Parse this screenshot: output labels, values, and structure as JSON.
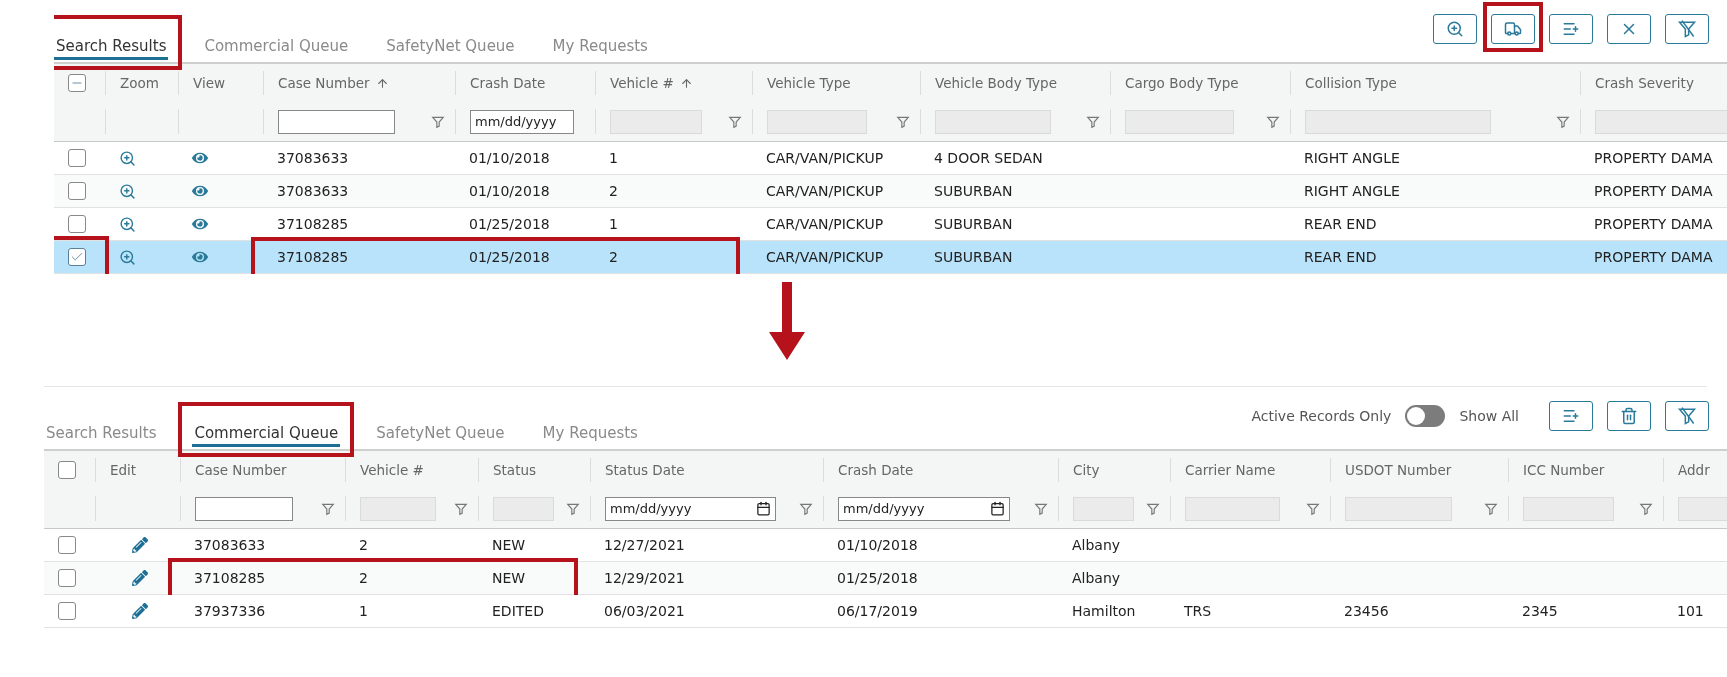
{
  "panels": [
    {
      "tabs": [
        {
          "label": "Search Results",
          "selected": true,
          "callout": true
        },
        {
          "label": "Commercial Queue",
          "selected": false,
          "callout": false
        },
        {
          "label": "SafetyNet Queue",
          "selected": false,
          "callout": false
        },
        {
          "label": "My Requests",
          "selected": false,
          "callout": false
        }
      ],
      "toolbar": [
        {
          "kind": "zoom",
          "callout": false
        },
        {
          "kind": "truck",
          "callout": true
        },
        {
          "kind": "add-list",
          "callout": false
        },
        {
          "kind": "close",
          "callout": false
        },
        {
          "kind": "clear-filter",
          "callout": false
        }
      ],
      "table": {
        "header_checkbox": {
          "indeterminate": true
        },
        "columns": [
          {
            "kind": "select"
          },
          {
            "kind": "zoom",
            "label": "Zoom"
          },
          {
            "kind": "view",
            "label": "View"
          },
          {
            "kind": "text",
            "label": "Case Number",
            "sorted": true,
            "callout": true,
            "filter": {
              "kind": "text",
              "button": true
            }
          },
          {
            "kind": "text",
            "label": "Crash Date",
            "sorted": false,
            "callout": true,
            "filter": {
              "kind": "date",
              "placeholder": "mm/dd/yyyy",
              "picker": false,
              "button": false
            }
          },
          {
            "kind": "text",
            "label": "Vehicle #",
            "sorted": true,
            "callout": true,
            "filter": {
              "kind": "disabled",
              "button": true
            }
          },
          {
            "kind": "text",
            "label": "Vehicle Type",
            "sorted": false,
            "callout": false,
            "filter": {
              "kind": "disabled",
              "button": true
            }
          },
          {
            "kind": "text",
            "label": "Vehicle Body Type",
            "sorted": false,
            "callout": false,
            "filter": {
              "kind": "disabled",
              "button": true
            }
          },
          {
            "kind": "text",
            "label": "Cargo Body Type",
            "sorted": false,
            "callout": false,
            "filter": {
              "kind": "disabled",
              "button": true
            }
          },
          {
            "kind": "text",
            "label": "Collision Type",
            "sorted": false,
            "callout": false,
            "filter": {
              "kind": "disabled",
              "button": true
            }
          },
          {
            "kind": "text",
            "label": "Crash Severity",
            "sorted": false,
            "callout": false,
            "filter": {
              "kind": "disabled"
            }
          }
        ],
        "rows": [
          {
            "selected": false,
            "checkbox_callout": false,
            "callout": false,
            "cells": [
              "",
              "",
              "",
              "37083633",
              "01/10/2018",
              "1",
              "CAR/VAN/PICKUP",
              "4 DOOR SEDAN",
              "",
              "RIGHT ANGLE",
              "PROPERTY DAMA"
            ]
          },
          {
            "selected": false,
            "checkbox_callout": false,
            "callout": false,
            "cells": [
              "",
              "",
              "",
              "37083633",
              "01/10/2018",
              "2",
              "CAR/VAN/PICKUP",
              "SUBURBAN",
              "",
              "RIGHT ANGLE",
              "PROPERTY DAMA"
            ]
          },
          {
            "selected": false,
            "checkbox_callout": false,
            "callout": false,
            "cells": [
              "",
              "",
              "",
              "37108285",
              "01/25/2018",
              "1",
              "CAR/VAN/PICKUP",
              "SUBURBAN",
              "",
              "REAR END",
              "PROPERTY DAMA"
            ]
          },
          {
            "selected": true,
            "checkbox_callout": true,
            "callout": true,
            "cells": [
              "",
              "",
              "",
              "37108285",
              "01/25/2018",
              "2",
              "CAR/VAN/PICKUP",
              "SUBURBAN",
              "",
              "REAR END",
              "PROPERTY DAMA"
            ]
          }
        ]
      }
    },
    {
      "tabs": [
        {
          "label": "Search Results",
          "selected": false,
          "callout": false
        },
        {
          "label": "Commercial Queue",
          "selected": true,
          "callout": true
        },
        {
          "label": "SafetyNet Queue",
          "selected": false,
          "callout": false
        },
        {
          "label": "My Requests",
          "selected": false,
          "callout": false
        }
      ],
      "toggle": {
        "label": "Active Records Only",
        "on": false,
        "alt_label": "Show All"
      },
      "toolbar": [
        {
          "kind": "add-list",
          "callout": false
        },
        {
          "kind": "trash",
          "callout": false
        },
        {
          "kind": "clear-filter",
          "callout": false
        }
      ],
      "table": {
        "header_checkbox": {
          "indeterminate": false
        },
        "columns": [
          {
            "kind": "select"
          },
          {
            "kind": "edit",
            "label": "Edit"
          },
          {
            "kind": "text",
            "label": "Case Number",
            "sorted": false,
            "callout": true,
            "filter": {
              "kind": "text",
              "button": true
            }
          },
          {
            "kind": "text",
            "label": "Vehicle #",
            "sorted": false,
            "callout": true,
            "filter": {
              "kind": "disabled",
              "button": true
            }
          },
          {
            "kind": "text",
            "label": "Status",
            "sorted": false,
            "callout": true,
            "filter": {
              "kind": "disabled",
              "button": true
            }
          },
          {
            "kind": "text",
            "label": "Status Date",
            "sorted": false,
            "callout": false,
            "filter": {
              "kind": "date",
              "placeholder": "mm/dd/yyyy",
              "picker": true,
              "button": true
            }
          },
          {
            "kind": "text",
            "label": "Crash Date",
            "sorted": false,
            "callout": false,
            "filter": {
              "kind": "date",
              "placeholder": "mm/dd/yyyy",
              "picker": true,
              "button": true
            }
          },
          {
            "kind": "text",
            "label": "City",
            "sorted": false,
            "callout": false,
            "filter": {
              "kind": "disabled",
              "button": true
            }
          },
          {
            "kind": "text",
            "label": "Carrier Name",
            "sorted": false,
            "callout": false,
            "filter": {
              "kind": "disabled",
              "button": true
            }
          },
          {
            "kind": "text",
            "label": "USDOT Number",
            "sorted": false,
            "callout": false,
            "filter": {
              "kind": "disabled",
              "button": true
            }
          },
          {
            "kind": "text",
            "label": "ICC Number",
            "sorted": false,
            "callout": false,
            "filter": {
              "kind": "disabled",
              "button": true
            }
          },
          {
            "kind": "text",
            "label": "Addr",
            "sorted": false,
            "callout": false,
            "filter": {
              "kind": "disabled"
            }
          }
        ],
        "rows": [
          {
            "selected": false,
            "checkbox_callout": false,
            "callout": false,
            "cells": [
              "",
              "",
              "37083633",
              "2",
              "NEW",
              "12/27/2021",
              "01/10/2018",
              "Albany",
              "",
              "",
              "",
              ""
            ]
          },
          {
            "selected": false,
            "checkbox_callout": false,
            "callout": true,
            "cells": [
              "",
              "",
              "37108285",
              "2",
              "NEW",
              "12/29/2021",
              "01/25/2018",
              "Albany",
              "",
              "",
              "",
              ""
            ]
          },
          {
            "selected": false,
            "checkbox_callout": false,
            "callout": false,
            "cells": [
              "",
              "",
              "37937336",
              "1",
              "EDITED",
              "06/03/2021",
              "06/17/2019",
              "Hamilton",
              "TRS",
              "23456",
              "2345",
              "101"
            ]
          }
        ]
      }
    }
  ]
}
